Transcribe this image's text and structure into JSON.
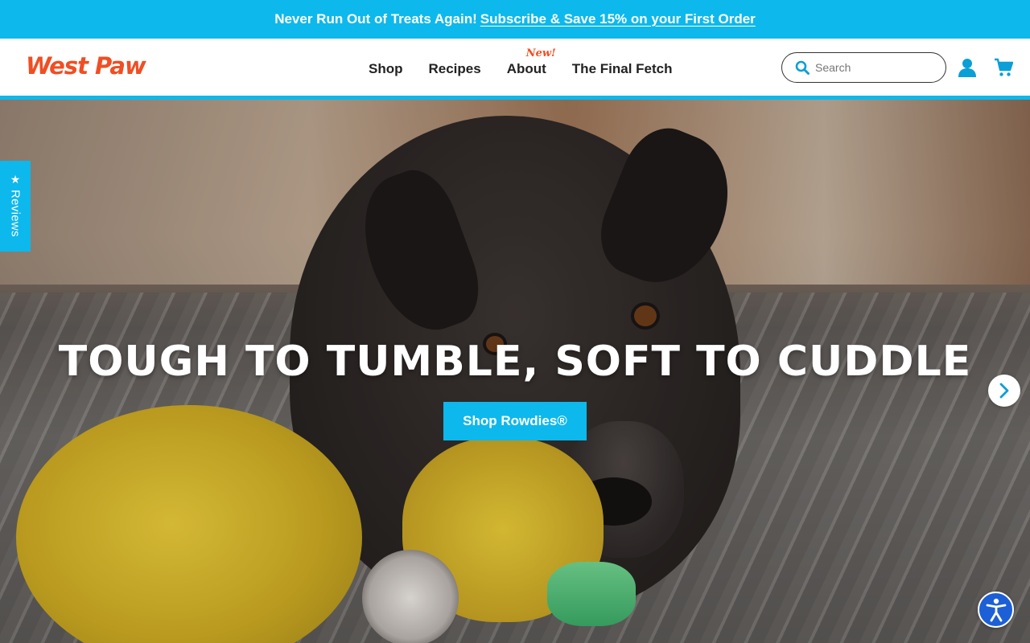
{
  "announcement": {
    "lead": "Never Run Out of Treats Again!",
    "link": "Subscribe & Save 15% on your First Order"
  },
  "header": {
    "logo": "West Paw",
    "nav": [
      {
        "label": "Shop"
      },
      {
        "label": "Recipes"
      },
      {
        "label": "About",
        "badge": "New!"
      },
      {
        "label": "The Final Fetch"
      }
    ],
    "search_placeholder": "Search",
    "icons": [
      "search-icon",
      "account-icon",
      "cart-icon"
    ]
  },
  "hero": {
    "title": "TOUGH TO TUMBLE, SOFT TO CUDDLE",
    "cta": "Shop Rowdies®",
    "next_icon": "chevron-right-icon"
  },
  "reviews_tab": {
    "star": "★",
    "label": "Reviews"
  },
  "accessibility": {
    "icon": "accessibility-icon"
  },
  "colors": {
    "accent": "#0db8ec",
    "brand": "#f04e23",
    "a11y": "#1d5fd6"
  }
}
